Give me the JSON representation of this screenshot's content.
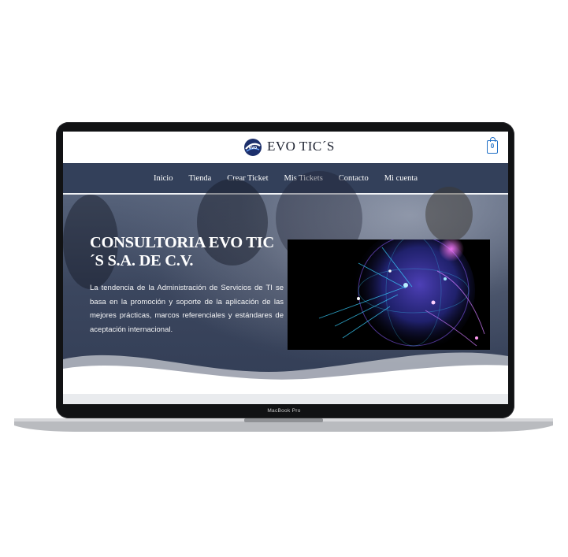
{
  "device": {
    "model_label": "MacBook Pro"
  },
  "header": {
    "brand_name": "EVO TIC´S",
    "logo_icon": "evo-globe-logo",
    "cart_count": "0"
  },
  "nav": {
    "items": [
      {
        "label": "Inicio"
      },
      {
        "label": "Tienda"
      },
      {
        "label": "Crear Ticket"
      },
      {
        "label": "Mis Tickets"
      },
      {
        "label": "Contacto"
      },
      {
        "label": "Mi cuenta"
      }
    ]
  },
  "hero": {
    "title": "CONSULTORIA EVO TIC´S S.A. DE C.V.",
    "text": "La tendencia de la Administración de Servicios de TI se basa en la promoción y soporte de la aplicación de las mejores prácticas, marcos referenciales y estándares de aceptación internacional."
  },
  "colors": {
    "nav_background": "#33405a",
    "accent_blue": "#1f6fc6",
    "globe_purple": "#8a5cff",
    "globe_cyan": "#38d0ff"
  }
}
